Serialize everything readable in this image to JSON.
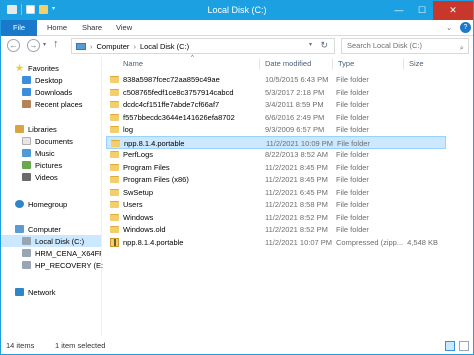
{
  "window": {
    "title": "Local Disk (C:)",
    "minimize_glyph": "—",
    "maximize_glyph": "☐",
    "close_glyph": "✕",
    "accent": "#1ba1e2"
  },
  "ribbon": {
    "tabs": [
      "File",
      "Home",
      "Share",
      "View"
    ]
  },
  "address": {
    "segments": [
      "Computer",
      "Local Disk (C:)"
    ],
    "separator": "›",
    "search_placeholder": "Search Local Disk (C:)"
  },
  "nav": {
    "favorites": {
      "label": "Favorites",
      "items": [
        "Desktop",
        "Downloads",
        "Recent places"
      ]
    },
    "libraries": {
      "label": "Libraries",
      "items": [
        "Documents",
        "Music",
        "Pictures",
        "Videos"
      ]
    },
    "homegroup": "Homegroup",
    "computer": {
      "label": "Computer",
      "items": [
        "Local Disk (C:)",
        "HRM_CENA_X64FRE",
        "HP_RECOVERY (E:)"
      ]
    },
    "network": "Network"
  },
  "columns": [
    "Name",
    "Date modified",
    "Type",
    "Size"
  ],
  "files": [
    {
      "name": "838a5987fcec72aa859c49ae",
      "date": "10/5/2015 6:43 PM",
      "type": "File folder",
      "size": "",
      "icon": "folder"
    },
    {
      "name": "c508765fedf1ce8c3757914cabcd",
      "date": "5/3/2017 2:18 PM",
      "type": "File folder",
      "size": "",
      "icon": "folder"
    },
    {
      "name": "dcdc4cf151ffe7abde7cf66af7",
      "date": "3/4/2011 8:59 PM",
      "type": "File folder",
      "size": "",
      "icon": "folder"
    },
    {
      "name": "f557bbecdc3644e141626efa8702",
      "date": "6/6/2016 2:49 PM",
      "type": "File folder",
      "size": "",
      "icon": "folder"
    },
    {
      "name": "log",
      "date": "9/3/2009 6:57 PM",
      "type": "File folder",
      "size": "",
      "icon": "folder"
    },
    {
      "name": "npp.8.1.4.portable",
      "date": "11/2/2021 10:09 PM",
      "type": "File folder",
      "size": "",
      "icon": "folder",
      "selected": true
    },
    {
      "name": "PerfLogs",
      "date": "8/22/2013 8:52 AM",
      "type": "File folder",
      "size": "",
      "icon": "folder"
    },
    {
      "name": "Program Files",
      "date": "11/2/2021 8:45 PM",
      "type": "File folder",
      "size": "",
      "icon": "folder"
    },
    {
      "name": "Program Files (x86)",
      "date": "11/2/2021 8:45 PM",
      "type": "File folder",
      "size": "",
      "icon": "folder"
    },
    {
      "name": "SwSetup",
      "date": "11/2/2021 6:45 PM",
      "type": "File folder",
      "size": "",
      "icon": "folder"
    },
    {
      "name": "Users",
      "date": "11/2/2021 8:58 PM",
      "type": "File folder",
      "size": "",
      "icon": "folder"
    },
    {
      "name": "Windows",
      "date": "11/2/2021 8:52 PM",
      "type": "File folder",
      "size": "",
      "icon": "folder"
    },
    {
      "name": "Windows.old",
      "date": "11/2/2021 8:52 PM",
      "type": "File folder",
      "size": "",
      "icon": "folder"
    },
    {
      "name": "npp.8.1.4.portable",
      "date": "11/2/2021 10:07 PM",
      "type": "Compressed (zipp...",
      "size": "4,548 KB",
      "icon": "zip"
    }
  ],
  "status": {
    "count": "14 items",
    "selected": "1 item selected"
  }
}
